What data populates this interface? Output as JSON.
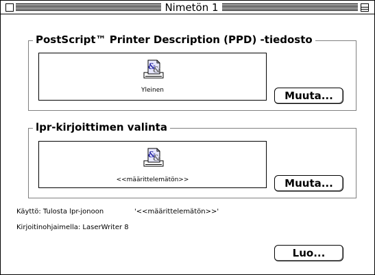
{
  "window": {
    "title": "Nimetön 1"
  },
  "ppd": {
    "group_title": "PostScript™ Printer Description (PPD) -tiedosto",
    "icon_caption": "Yleinen",
    "change_label": "Muuta..."
  },
  "lpr": {
    "group_title": "lpr-kirjoittimen valinta",
    "icon_caption": "<<määrittelemätön>>",
    "change_label": "Muuta..."
  },
  "info": {
    "usage_text": "Käyttö: Tulosta lpr-jonoon",
    "usage_queue": "'<<määrittelemätön>>'",
    "driver_text": "Kirjoitinohjaimella:  LaserWriter 8"
  },
  "actions": {
    "create_label": "Luo..."
  },
  "icons": {
    "ppd_icon": "printer-document-icon",
    "lpr_icon": "printer-document-icon"
  }
}
